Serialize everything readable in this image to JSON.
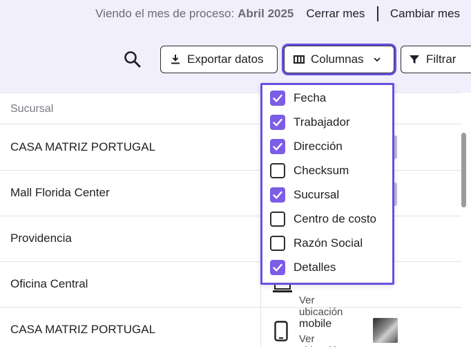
{
  "period": {
    "label": "Viendo el mes de proceso:",
    "value": "Abril 2025",
    "close_month": "Cerrar mes",
    "change_month": "Cambiar mes"
  },
  "toolbar": {
    "search_icon": "search-icon",
    "export_label": "Exportar datos",
    "columns_label": "Columnas",
    "filter_label": "Filtrar"
  },
  "table": {
    "header": "Sucursal",
    "rows": [
      "CASA MATRIZ PORTUGAL",
      "Mall Florida Center",
      "Providencia",
      "Oficina Central",
      "CASA MATRIZ PORTUGAL"
    ],
    "devices": [
      {
        "location": "Ver ubicación"
      },
      {
        "type": "mobile",
        "location": "Ver ubicación"
      }
    ]
  },
  "columns_menu": {
    "items": [
      {
        "label": "Fecha",
        "checked": true
      },
      {
        "label": "Trabajador",
        "checked": true
      },
      {
        "label": "Dirección",
        "checked": true
      },
      {
        "label": "Checksum",
        "checked": false
      },
      {
        "label": "Sucursal",
        "checked": true
      },
      {
        "label": "Centro de costo",
        "checked": false
      },
      {
        "label": "Razón Social",
        "checked": false
      },
      {
        "label": "Detalles",
        "checked": true
      }
    ]
  },
  "colors": {
    "accent": "#6a4ee0",
    "checkbox_on": "#7b5de6",
    "topbar_bg": "#f1effb"
  }
}
